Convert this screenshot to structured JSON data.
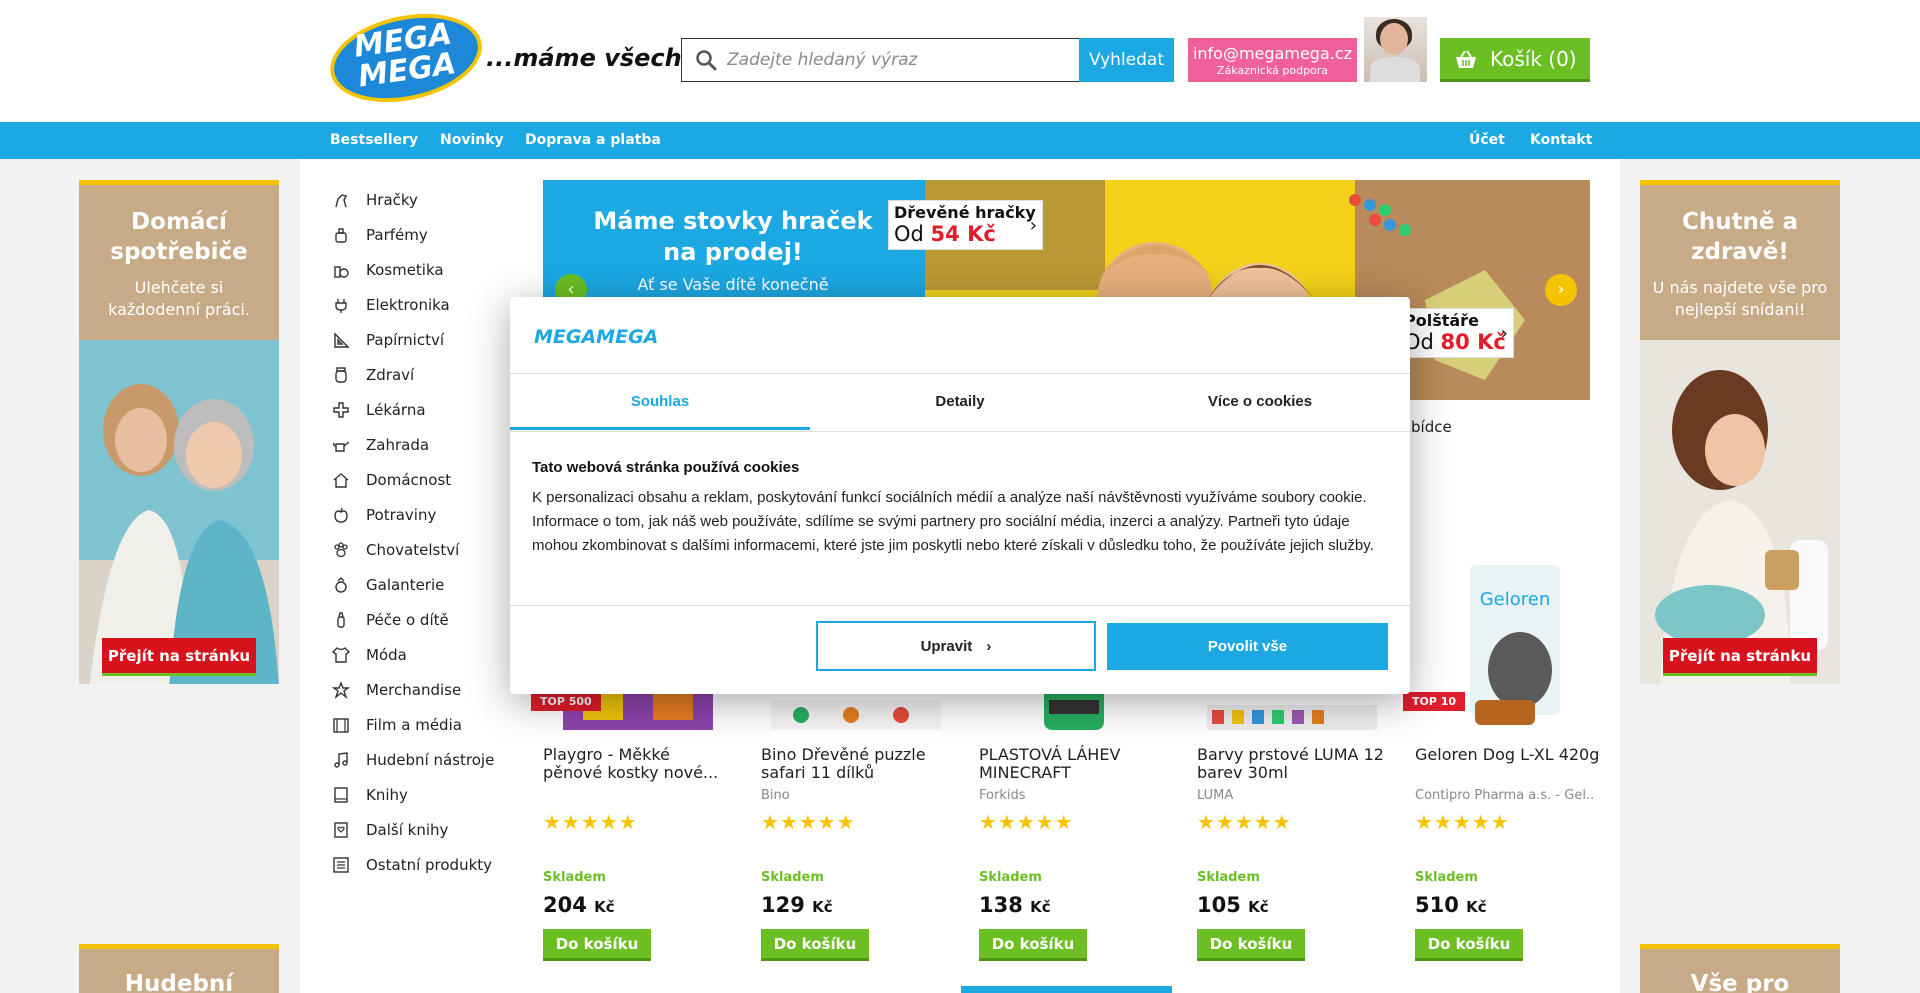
{
  "header": {
    "logo_text": "MEGA MEGA",
    "slogan": "...máme všechno!",
    "search_placeholder": "Zadejte hledaný výraz",
    "search_button": "Vyhledat",
    "support_email": "info@megamega.cz",
    "support_label": "Zákaznická podpora",
    "cart_label": "Košík (0)"
  },
  "nav": {
    "left": [
      "Bestsellery",
      "Novinky",
      "Doprava a platba"
    ],
    "right": [
      "Účet",
      "Kontakt"
    ]
  },
  "categories": [
    {
      "label": "Hračky",
      "icon": "horse-icon"
    },
    {
      "label": "Parfémy",
      "icon": "perfume-icon"
    },
    {
      "label": "Kosmetika",
      "icon": "cosmetics-icon"
    },
    {
      "label": "Elektronika",
      "icon": "plug-icon"
    },
    {
      "label": "Papírnictví",
      "icon": "triangle-ruler-icon"
    },
    {
      "label": "Zdraví",
      "icon": "jar-icon"
    },
    {
      "label": "Lékárna",
      "icon": "medical-cross-icon"
    },
    {
      "label": "Zahrada",
      "icon": "watering-can-icon"
    },
    {
      "label": "Domácnost",
      "icon": "house-icon"
    },
    {
      "label": "Potraviny",
      "icon": "apple-icon"
    },
    {
      "label": "Chovatelství",
      "icon": "paw-icon"
    },
    {
      "label": "Galanterie",
      "icon": "ring-icon"
    },
    {
      "label": "Péče o dítě",
      "icon": "baby-bottle-icon"
    },
    {
      "label": "Móda",
      "icon": "tshirt-icon"
    },
    {
      "label": "Merchandise",
      "icon": "star-icon"
    },
    {
      "label": "Film a média",
      "icon": "film-icon"
    },
    {
      "label": "Hudební nástroje",
      "icon": "music-note-icon"
    },
    {
      "label": "Knihy",
      "icon": "book-icon"
    },
    {
      "label": "Další knihy",
      "icon": "book-heart-icon"
    },
    {
      "label": "Ostatní produkty",
      "icon": "list-icon"
    }
  ],
  "left_banner": {
    "title": "Domácí spotřebiče",
    "subtitle": "Ulehčete si každodenní práci.",
    "button": "Přejít na stránku",
    "bottom_title": "Hudební"
  },
  "right_banner": {
    "title": "Chutně a zdravě!",
    "subtitle": "U nás najdete vše pro nejlepší snídani!",
    "button": "Přejít na stránku",
    "bottom_title": "Vše pro"
  },
  "hero": {
    "title": "Máme stovky hraček na prodej!",
    "subtitle": "Ať se Vaše dítě konečně",
    "tag1_title": "Dřevěné hračky",
    "tag1_prefix": "Od",
    "tag1_price": "54 Kč",
    "tag2_title": "Polštáře",
    "tag2_prefix": "Od",
    "tag2_price": "80 Kč",
    "under_text": "bídce"
  },
  "products": [
    {
      "name": "Playgro - Měkké pěnové kostky nové...",
      "brand": "",
      "badge": "TOP 500",
      "stock": "Skladem",
      "price": "204",
      "currency": "Kč",
      "button": "Do košíku"
    },
    {
      "name": "Bino Dřevěné puzzle safari 11 dílků",
      "brand": "Bino",
      "badge": "",
      "stock": "Skladem",
      "price": "129",
      "currency": "Kč",
      "button": "Do košíku"
    },
    {
      "name": "PLASTOVÁ LÁHEV MINECRAFT",
      "brand": "Forkids",
      "badge": "",
      "stock": "Skladem",
      "price": "138",
      "currency": "Kč",
      "button": "Do košíku"
    },
    {
      "name": "Barvy prstové LUMA 12 barev 30ml",
      "brand": "LUMA",
      "badge": "",
      "stock": "Skladem",
      "price": "105",
      "currency": "Kč",
      "button": "Do košíku"
    },
    {
      "name": "Geloren Dog L-XL 420g",
      "brand": "Contipro Pharma a.s. - Gel...",
      "badge": "TOP 10",
      "stock": "Skladem",
      "price": "510",
      "currency": "Kč",
      "button": "Do košíku"
    }
  ],
  "product_rating_stars": 5,
  "cookie": {
    "logo": "MEGAMEGA",
    "tabs": [
      "Souhlas",
      "Detaily",
      "Více o cookies"
    ],
    "active_tab": "Souhlas",
    "heading": "Tato webová stránka používá cookies",
    "text": "K personalizaci obsahu a reklam, poskytování funkcí sociálních médií a analýze naší návštěvnosti využíváme soubory cookie. Informace o tom, jak náš web používáte, sdílíme se svými partnery pro sociální média, inzerci a analýzy. Partneři tyto údaje mohou zkombinovat s dalšími informacemi, které jste jim poskytli nebo které získali v důsledku toho, že používáte jejich služby.",
    "edit_button": "Upravit",
    "allow_button": "Povolit vše"
  },
  "colors": {
    "brand_blue": "#1ba8e3",
    "cart_green": "#6cbf23",
    "support_pink": "#f0609a",
    "sale_red": "#e11d2c",
    "banner_beige": "#c7ab87",
    "accent_yellow": "#f5c400"
  }
}
